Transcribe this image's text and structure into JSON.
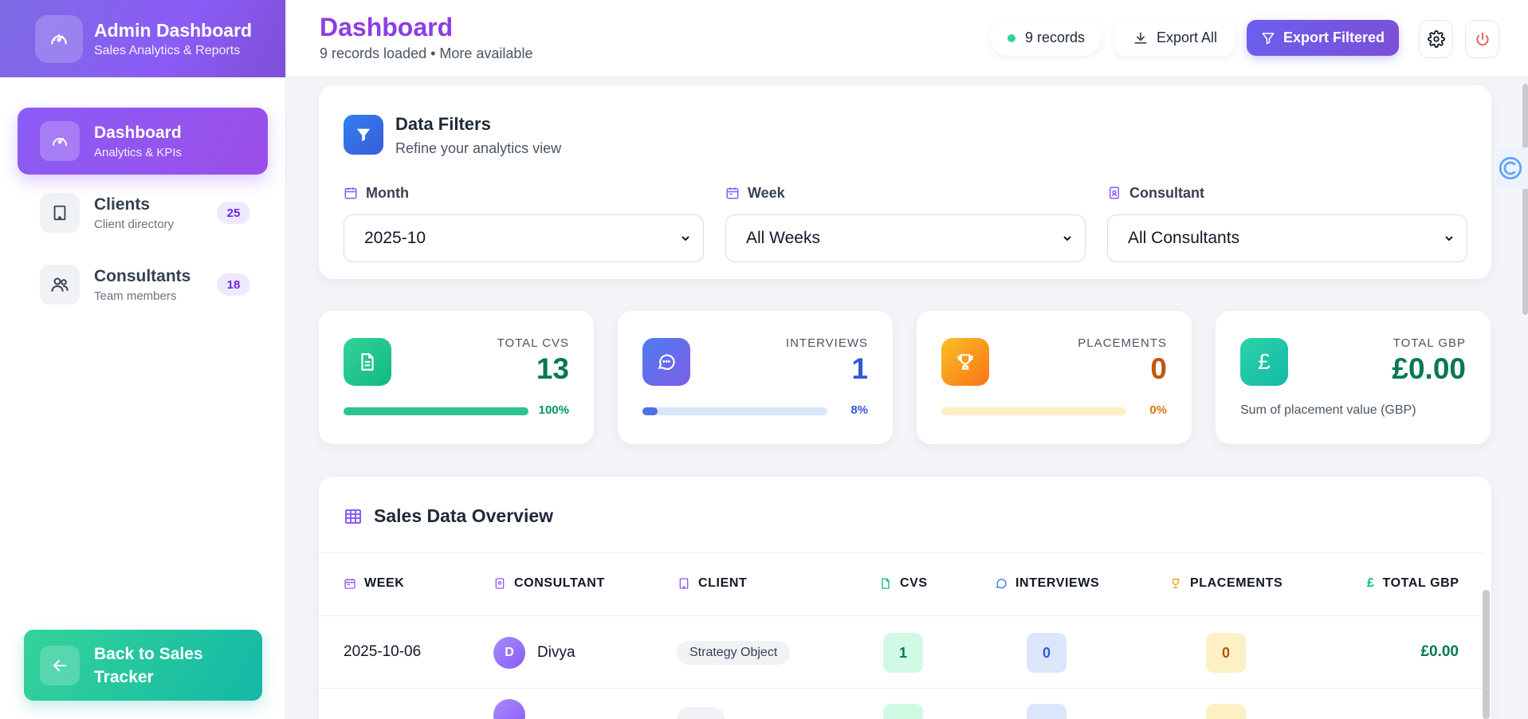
{
  "brand": {
    "title": "Admin Dashboard",
    "subtitle": "Sales Analytics & Reports"
  },
  "sidebar": {
    "items": [
      {
        "label": "Dashboard",
        "sub": "Analytics & KPIs",
        "icon": "gauge-icon",
        "badge": ""
      },
      {
        "label": "Clients",
        "sub": "Client directory",
        "icon": "building-icon",
        "badge": "25"
      },
      {
        "label": "Consultants",
        "sub": "Team members",
        "icon": "users-icon",
        "badge": "18"
      }
    ],
    "back_label": "Back to Sales Tracker"
  },
  "header": {
    "title": "Dashboard",
    "subtitle": "9 records loaded • More available",
    "records_label": "9 records",
    "export_all_label": "Export All",
    "export_filtered_label": "Export Filtered"
  },
  "filters": {
    "title": "Data Filters",
    "subtitle": "Refine your analytics view",
    "month": {
      "label": "Month",
      "value": "2025-10"
    },
    "week": {
      "label": "Week",
      "value": "All Weeks"
    },
    "consultant": {
      "label": "Consultant",
      "value": "All Consultants"
    }
  },
  "stats": {
    "cvs": {
      "label": "TOTAL CVS",
      "value": "13",
      "percent": "100%",
      "fill": 1.0
    },
    "interviews": {
      "label": "INTERVIEWS",
      "value": "1",
      "percent": "8%",
      "fill": 0.08
    },
    "placements": {
      "label": "PLACEMENTS",
      "value": "0",
      "percent": "0%",
      "fill": 0.0
    },
    "gbp": {
      "label": "TOTAL GBP",
      "value": "£0.00",
      "note": "Sum of placement value (GBP)",
      "symbol": "£"
    }
  },
  "table": {
    "title": "Sales Data Overview",
    "headers": [
      "WEEK",
      "CONSULTANT",
      "CLIENT",
      "CVS",
      "INTERVIEWS",
      "PLACEMENTS",
      "TOTAL GBP"
    ],
    "gbp_symbol": "£",
    "rows": [
      {
        "week": "2025-10-06",
        "initial": "D",
        "consultant": "Divya",
        "client": "Strategy Object",
        "cvs": "1",
        "interviews": "0",
        "placements": "0",
        "gbp": "£0.00"
      }
    ]
  },
  "colors": {
    "accent": "#8b5cf6",
    "cvs": "#10b981",
    "interviews": "#3b6de0",
    "placements": "#d97706",
    "gbp": "#047857"
  }
}
